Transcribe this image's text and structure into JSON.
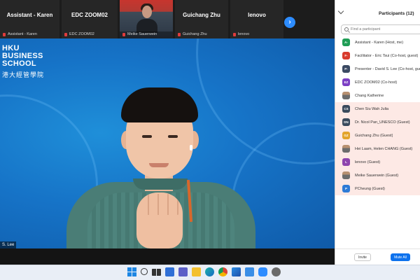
{
  "meeting": {
    "strip_tiles": [
      {
        "name": "Assistant - Karen",
        "label": "Assistant - Karen"
      },
      {
        "name": "EDC ZOOM02",
        "label": "EDC ZOOM02"
      },
      {
        "name": "",
        "label": "Meike Sauerwein"
      },
      {
        "name": "Guichang Zhu",
        "label": "Guichang Zhu"
      },
      {
        "name": "lenovo",
        "label": "lenovo"
      }
    ],
    "next_page_icon": "chevron-right-icon",
    "speaker_name_tag": "S. Lee",
    "brand": {
      "lines": [
        "HKU",
        "BUSINESS",
        "SCHOOL"
      ],
      "cjk": "港大經管學院"
    }
  },
  "participants": {
    "title": "Participants (12)",
    "search_placeholder": "Find a participant",
    "items": [
      {
        "initials": "A-",
        "color": "#1f9d55",
        "name": "Assistant - Karen (Host, me)"
      },
      {
        "initials": "F-",
        "color": "#d83b2d",
        "name": "Facilitator - Eric Tsui (Co-host, guest)"
      },
      {
        "initials": "P-",
        "color": "#3b4a63",
        "name": "Presenter - David S. Lee (Co-host, guest)"
      },
      {
        "initials": "EZ",
        "color": "#7b3fc4",
        "name": "EDC ZOOM02 (Co-host)"
      },
      {
        "initials": "",
        "color": "#8a6f55",
        "name": "Chang Katherine",
        "photo": true
      },
      {
        "initials": "CS",
        "color": "#3a4a5c",
        "name": "Chen Siu Wah Julia"
      },
      {
        "initials": "DN",
        "color": "#3a4a5c",
        "name": "Dr. Nicol Pan_UNESCO (Guest)"
      },
      {
        "initials": "GZ",
        "color": "#e3a32a",
        "name": "Guichang Zhu (Guest)"
      },
      {
        "initials": "",
        "color": "#8a6f55",
        "name": "Hei Laam, Helen CHANG (Guest)",
        "photo": true
      },
      {
        "initials": "L",
        "color": "#8e44ad",
        "name": "lenovo (Guest)"
      },
      {
        "initials": "",
        "color": "#8a6f55",
        "name": "Meike Sauerwein (Guest)",
        "photo": true
      },
      {
        "initials": "P",
        "color": "#2e7bd6",
        "name": "PCheung (Guest)"
      }
    ],
    "invite_label": "Invite",
    "mute_all_label": "Mute All"
  },
  "taskbar": {
    "icons": [
      "windows-start-icon",
      "search-icon",
      "task-view-icon",
      "widgets-icon",
      "teams-chat-icon",
      "file-explorer-icon",
      "edge-browser-icon",
      "chrome-browser-icon",
      "photos-icon",
      "snipping-tool-icon",
      "zoom-app-icon",
      "settings-icon"
    ]
  }
}
